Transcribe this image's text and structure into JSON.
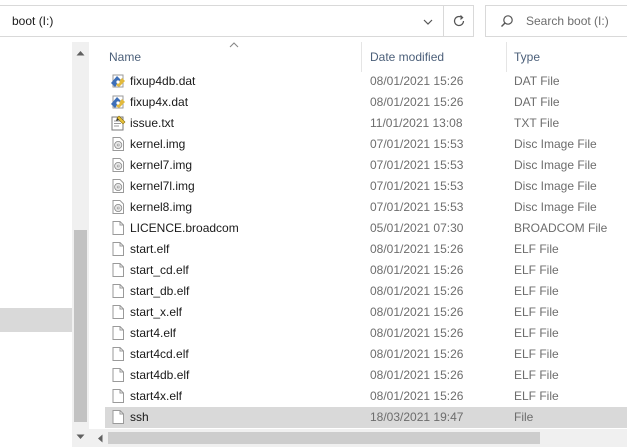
{
  "address": {
    "path": "boot (I:)",
    "history_dropdown_icon": "chevron-down-icon",
    "refresh_icon": "refresh-icon"
  },
  "search": {
    "placeholder": "Search boot (I:)",
    "icon": "search-icon"
  },
  "columns": {
    "name": "Name",
    "date": "Date modified",
    "type": "Type",
    "sort": "ascending"
  },
  "files": [
    {
      "name": "fixup4db.dat",
      "date": "08/01/2021 15:26",
      "type": "DAT File",
      "icon": "dat-file-icon"
    },
    {
      "name": "fixup4x.dat",
      "date": "08/01/2021 15:26",
      "type": "DAT File",
      "icon": "dat-file-icon"
    },
    {
      "name": "issue.txt",
      "date": "11/01/2021 13:08",
      "type": "TXT File",
      "icon": "text-file-icon"
    },
    {
      "name": "kernel.img",
      "date": "07/01/2021 15:53",
      "type": "Disc Image File",
      "icon": "disc-image-icon"
    },
    {
      "name": "kernel7.img",
      "date": "07/01/2021 15:53",
      "type": "Disc Image File",
      "icon": "disc-image-icon"
    },
    {
      "name": "kernel7l.img",
      "date": "07/01/2021 15:53",
      "type": "Disc Image File",
      "icon": "disc-image-icon"
    },
    {
      "name": "kernel8.img",
      "date": "07/01/2021 15:53",
      "type": "Disc Image File",
      "icon": "disc-image-icon"
    },
    {
      "name": "LICENCE.broadcom",
      "date": "05/01/2021 07:30",
      "type": "BROADCOM File",
      "icon": "generic-file-icon"
    },
    {
      "name": "start.elf",
      "date": "08/01/2021 15:26",
      "type": "ELF File",
      "icon": "generic-file-icon"
    },
    {
      "name": "start_cd.elf",
      "date": "08/01/2021 15:26",
      "type": "ELF File",
      "icon": "generic-file-icon"
    },
    {
      "name": "start_db.elf",
      "date": "08/01/2021 15:26",
      "type": "ELF File",
      "icon": "generic-file-icon"
    },
    {
      "name": "start_x.elf",
      "date": "08/01/2021 15:26",
      "type": "ELF File",
      "icon": "generic-file-icon"
    },
    {
      "name": "start4.elf",
      "date": "08/01/2021 15:26",
      "type": "ELF File",
      "icon": "generic-file-icon"
    },
    {
      "name": "start4cd.elf",
      "date": "08/01/2021 15:26",
      "type": "ELF File",
      "icon": "generic-file-icon"
    },
    {
      "name": "start4db.elf",
      "date": "08/01/2021 15:26",
      "type": "ELF File",
      "icon": "generic-file-icon"
    },
    {
      "name": "start4x.elf",
      "date": "08/01/2021 15:26",
      "type": "ELF File",
      "icon": "generic-file-icon"
    },
    {
      "name": "ssh",
      "date": "18/03/2021 19:47",
      "type": "File",
      "icon": "generic-file-icon",
      "selected": true
    }
  ],
  "colors": {
    "selection": "#d9d9d9",
    "header_text": "#4c607a",
    "secondary_text": "#6d6d6d"
  }
}
